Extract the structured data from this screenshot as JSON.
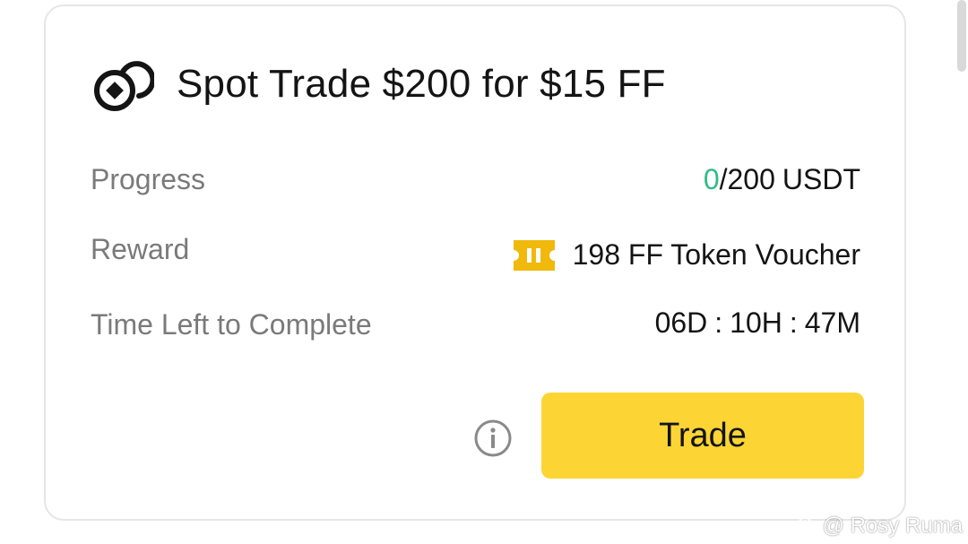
{
  "task": {
    "title": "Spot Trade $200 for $15 FF",
    "icon": "coins-icon"
  },
  "progress": {
    "label": "Progress",
    "current": "0",
    "target": "/200",
    "unit": "USDT",
    "current_color": "#2ebd85"
  },
  "reward": {
    "label": "Reward",
    "icon": "voucher-ticket-icon",
    "value": "198 FF Token Voucher",
    "icon_color": "#f0b90b"
  },
  "time_left": {
    "label": "Time Left to Complete",
    "days": "06D",
    "hours": "10H",
    "minutes": "47M",
    "separator": ":"
  },
  "actions": {
    "info_icon": "info-icon",
    "trade_label": "Trade",
    "trade_color": "#fcd535"
  },
  "watermark": {
    "text": "@ Rosy Ruma"
  }
}
